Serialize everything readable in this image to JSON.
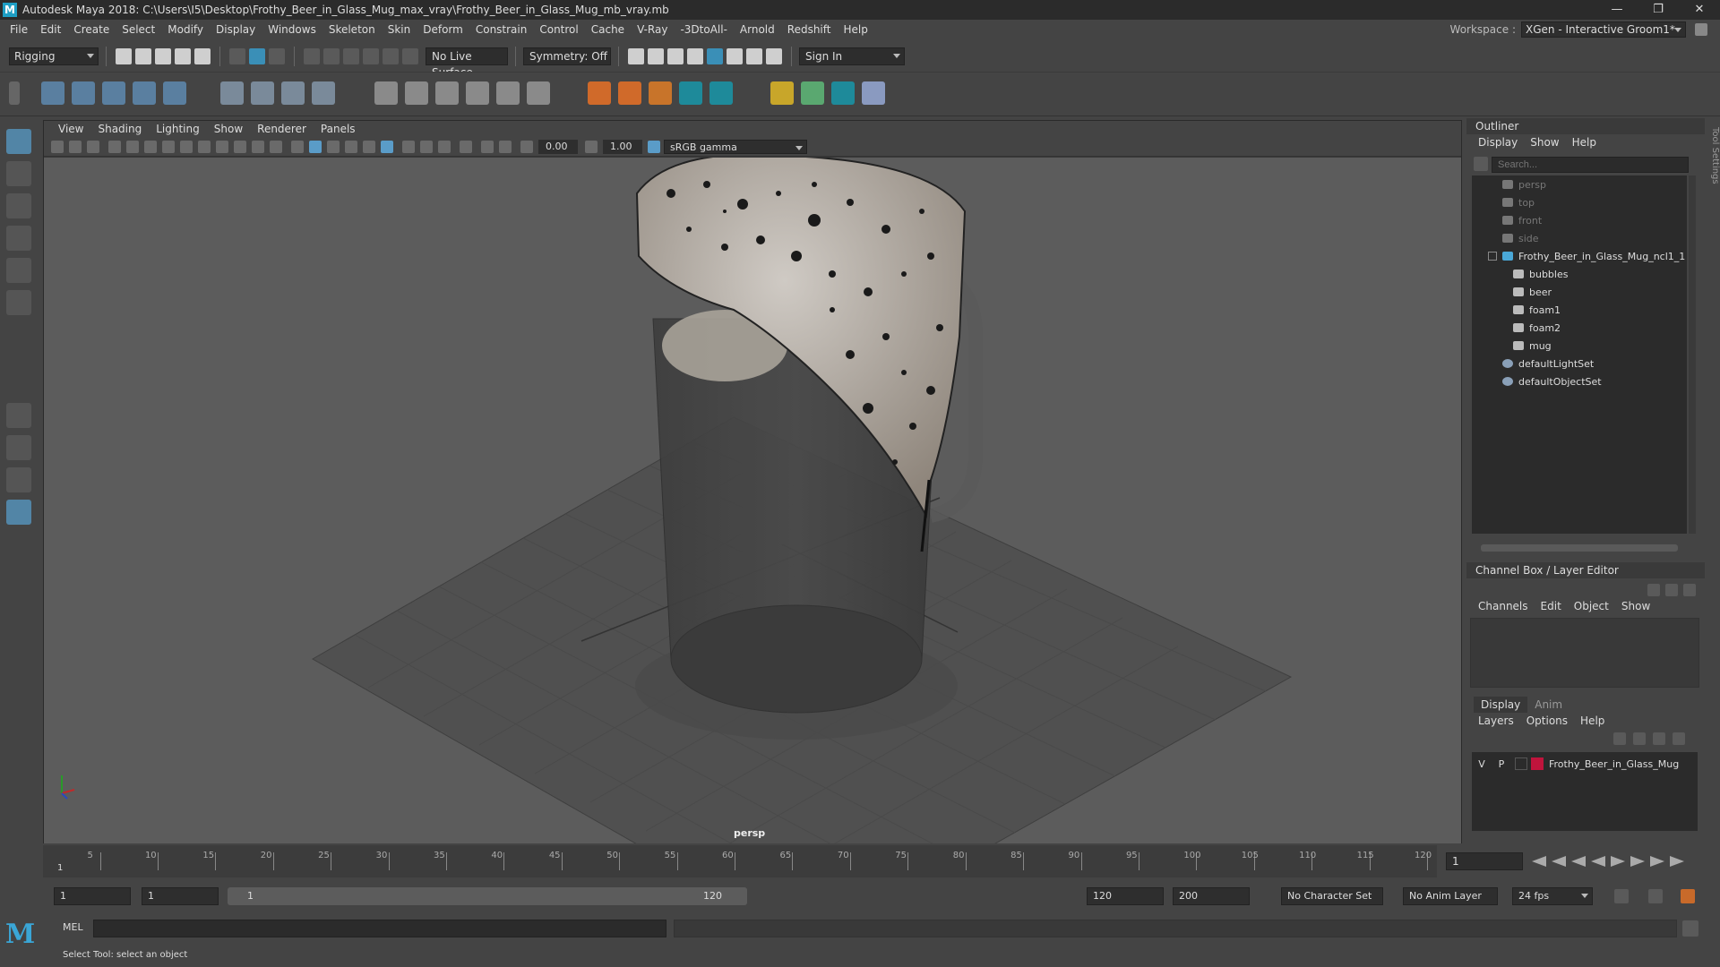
{
  "window": {
    "title": "Autodesk Maya 2018: C:\\Users\\I5\\Desktop\\Frothy_Beer_in_Glass_Mug_max_vray\\Frothy_Beer_in_Glass_Mug_mb_vray.mb",
    "controls": [
      "—",
      "❐",
      "✕"
    ]
  },
  "menubar": [
    "File",
    "Edit",
    "Create",
    "Select",
    "Modify",
    "Display",
    "Windows",
    "Skeleton",
    "Skin",
    "Deform",
    "Constrain",
    "Control",
    "Cache",
    "V-Ray",
    "-3DtoAll-",
    "Arnold",
    "Redshift",
    "Help"
  ],
  "workspace": {
    "label": "Workspace :",
    "value": "XGen - Interactive Groom1*"
  },
  "statusline": {
    "menuset": "Rigging",
    "live_surface": "No Live Surface",
    "symmetry": "Symmetry: Off",
    "signin": "Sign In"
  },
  "viewport": {
    "menus": [
      "View",
      "Shading",
      "Lighting",
      "Show",
      "Renderer",
      "Panels"
    ],
    "exposure": "0.00",
    "gamma_value": "1.00",
    "color_space": "sRGB gamma",
    "camera_label": "persp"
  },
  "outliner": {
    "title": "Outliner",
    "menus": [
      "Display",
      "Show",
      "Help"
    ],
    "search_placeholder": "Search...",
    "items": [
      {
        "label": "persp",
        "kind": "camera",
        "dim": true
      },
      {
        "label": "top",
        "kind": "camera",
        "dim": true
      },
      {
        "label": "front",
        "kind": "camera",
        "dim": true
      },
      {
        "label": "side",
        "kind": "camera",
        "dim": true
      },
      {
        "label": "Frothy_Beer_in_Glass_Mug_ncl1_1",
        "kind": "group",
        "dim": false
      },
      {
        "label": "bubbles",
        "kind": "mesh",
        "dim": false
      },
      {
        "label": "beer",
        "kind": "mesh",
        "dim": false
      },
      {
        "label": "foam1",
        "kind": "mesh",
        "dim": false
      },
      {
        "label": "foam2",
        "kind": "mesh",
        "dim": false
      },
      {
        "label": "mug",
        "kind": "mesh",
        "dim": false
      },
      {
        "label": "defaultLightSet",
        "kind": "set",
        "dim": false
      },
      {
        "label": "defaultObjectSet",
        "kind": "set",
        "dim": false
      }
    ]
  },
  "channelbox": {
    "title": "Channel Box / Layer Editor",
    "menus": [
      "Channels",
      "Edit",
      "Object",
      "Show"
    ]
  },
  "layereditor": {
    "tabs": [
      "Display",
      "Anim"
    ],
    "menus": [
      "Layers",
      "Options",
      "Help"
    ],
    "layer": {
      "v": "V",
      "p": "P",
      "name": "Frothy_Beer_in_Glass_Mug",
      "color": "#c0143c"
    }
  },
  "sidetab": "Tool Settings",
  "timeline": {
    "ticks": [
      "5",
      "10",
      "15",
      "20",
      "25",
      "30",
      "35",
      "40",
      "45",
      "50",
      "55",
      "60",
      "65",
      "70",
      "75",
      "80",
      "85",
      "90",
      "95",
      "100",
      "105",
      "110",
      "115",
      "120"
    ],
    "current_frame": "1",
    "current_frame_field": "1"
  },
  "range": {
    "start": "1",
    "playback_start": "1",
    "slider_start": "1",
    "slider_end": "120",
    "playback_end": "120",
    "end": "200",
    "character_set": "No Character Set",
    "anim_layer": "No Anim Layer",
    "fps": "24 fps"
  },
  "cmdline": {
    "label": "MEL"
  },
  "helpline": {
    "text": "Select Tool: select an object"
  }
}
